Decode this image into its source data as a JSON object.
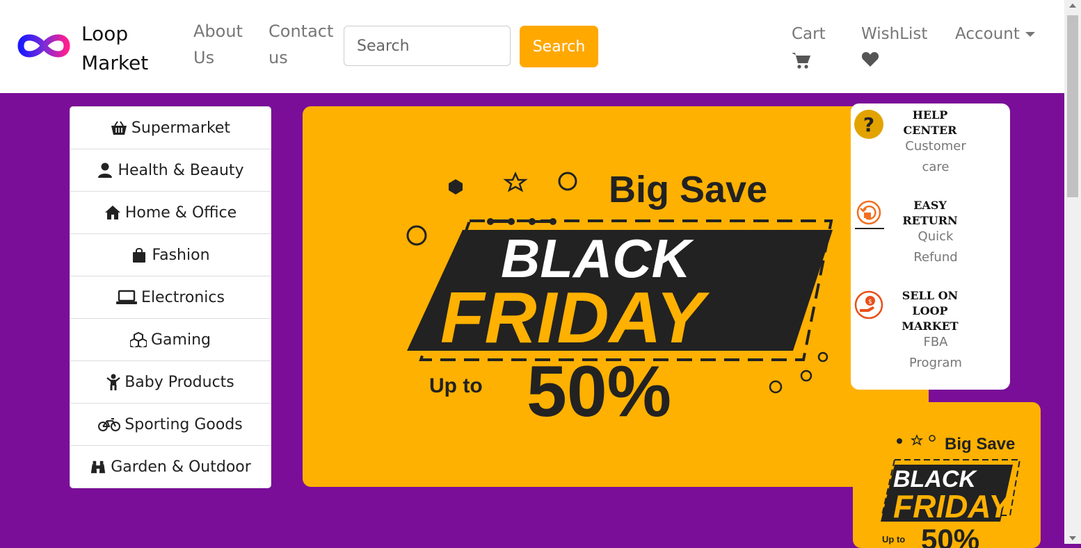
{
  "brand": {
    "line1": "Loop",
    "line2": "Market"
  },
  "nav": {
    "about_l1": "About",
    "about_l2": "Us",
    "contact_l1": "Contact",
    "contact_l2": "us"
  },
  "search": {
    "placeholder": "Search",
    "button": "Search"
  },
  "right_nav": {
    "cart": "Cart",
    "wishlist": "WishList",
    "account": "Account"
  },
  "categories": [
    {
      "label": "Supermarket",
      "icon": "basket-icon"
    },
    {
      "label": "Health & Beauty",
      "icon": "user-icon"
    },
    {
      "label": "Home & Office",
      "icon": "home-icon"
    },
    {
      "label": "Fashion",
      "icon": "shopping-bag-icon"
    },
    {
      "label": "Electronics",
      "icon": "laptop-icon"
    },
    {
      "label": "Gaming",
      "icon": "cubes-icon"
    },
    {
      "label": "Baby Products",
      "icon": "child-icon"
    },
    {
      "label": "Sporting Goods",
      "icon": "bicycle-icon"
    },
    {
      "label": "Garden & Outdoor",
      "icon": "binoculars-icon"
    }
  ],
  "banner": {
    "big_save": "Big Save",
    "black": "BLACK",
    "friday": "FRIDAY",
    "up_to": "Up to",
    "percent": "50%"
  },
  "help": [
    {
      "title_l1": "HELP",
      "title_l2": "CENTER",
      "sub_l1": "Customer",
      "sub_l2": "care",
      "icon": "question-icon"
    },
    {
      "title_l1": "EASY",
      "title_l2": "RETURN",
      "sub_l1": "Quick",
      "sub_l2": "Refund",
      "icon": "return-icon"
    },
    {
      "title_l1": "SELL ON",
      "title_l2": "LOOP",
      "title_l3": "MARKET",
      "sub_l1": "FBA",
      "sub_l2": "Program",
      "icon": "money-hand-icon"
    }
  ],
  "colors": {
    "accent": "#ffa800",
    "background": "#7a0e98",
    "banner": "#ffb101"
  }
}
